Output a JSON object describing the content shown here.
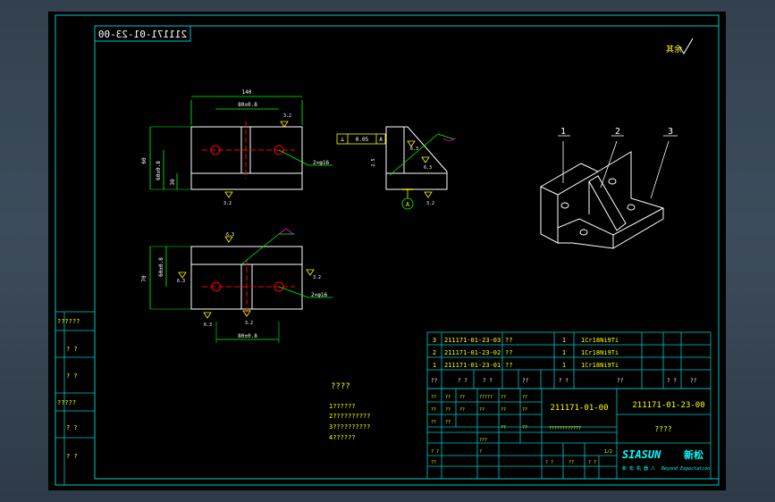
{
  "drawing": {
    "title_code_mirrored": "211171-01-23-00",
    "roughness_mark": "其余",
    "dims": {
      "top_width": "140",
      "top_hole_spacing": "80±0.8",
      "top_height": "60",
      "top_height_sub": "60±0.8",
      "top_small": "30",
      "hole_callout_top": "2×φ16",
      "front_height": "70",
      "front_height_sub": "60±0.8",
      "front_hole_spacing": "80±0.8",
      "hole_callout_front": "2×φ16",
      "side_ref": "2.5",
      "rough_1": "3.2",
      "rough_2": "3.2",
      "rough_3": "6.3",
      "rough_4": "6.3",
      "rough_5": "3.2",
      "rough_6": "6.3",
      "rough_7": "6.3",
      "rough_8": "3.2",
      "rough_9": "6.3",
      "rough_10": "3.2",
      "tolerance_box": [
        "⊥",
        "0.05",
        "A"
      ],
      "datum": "A"
    },
    "iso_labels": [
      "1",
      "2",
      "3"
    ],
    "tech_title": "????",
    "tech_notes": [
      "1??????",
      "2??????????",
      "3??????????",
      "4??????"
    ]
  },
  "left_column": [
    "??????",
    "? ?",
    "? ?",
    "?????",
    "? ?",
    "? ?"
  ],
  "bom": [
    {
      "no": "3",
      "code": "211171-01-23-03",
      "name": "??",
      "qty": "1",
      "material": "1Cr18Ni9Ti"
    },
    {
      "no": "2",
      "code": "211171-01-23-02",
      "name": "??",
      "qty": "1",
      "material": "1Cr18Ni9Ti"
    },
    {
      "no": "1",
      "code": "211171-01-23-01",
      "name": "??",
      "qty": "1",
      "material": "1Cr18Ni9Ti"
    }
  ],
  "bom_header": [
    "??",
    "? ?",
    "? ?",
    "??",
    "? ?",
    "??",
    "? ?",
    "??"
  ],
  "title_block": {
    "assembly_code": "211171-01-00",
    "drawing_code": "211171-01-23-00",
    "drawing_name": "????",
    "material_note": "????????????",
    "grid_cells": [
      "??",
      "??",
      "??",
      "?????",
      "??",
      "??",
      "??",
      "??",
      "??",
      "??",
      "??",
      "??",
      "??",
      "??",
      "???",
      "??",
      "??",
      "? ?",
      "?",
      "??",
      "? ?",
      "??",
      "? ?",
      "1/2"
    ],
    "logo": "SIASUN",
    "logo_cn": "新松",
    "logo_sub_cn": "新 松 机 器 人",
    "logo_sub_en": "Beyond Expectation"
  }
}
